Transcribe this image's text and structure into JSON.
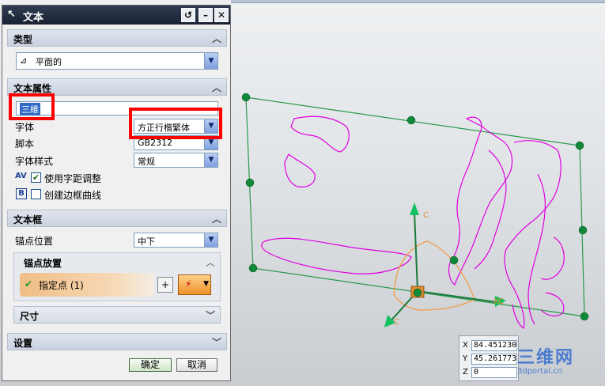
{
  "dialog": {
    "title": "文本",
    "buttons": {
      "reset": "↺",
      "minimize": "–",
      "close": "✕"
    },
    "type_section": {
      "header": "类型",
      "value": "平面的"
    },
    "text_props": {
      "header": "文本属性",
      "text_input": "三維",
      "font_label": "字体",
      "font_value": "方正行楷繁体",
      "script_label": "脚本",
      "script_value": "GB2312",
      "style_label": "字体样式",
      "style_value": "常规",
      "kerning_label": "使用字距调整",
      "kerning_checked": true,
      "border_label": "创建边框曲线",
      "border_checked": false
    },
    "text_frame": {
      "header": "文本框",
      "anchor_label": "锚点位置",
      "anchor_value": "中下",
      "placement_header": "锚点放置",
      "specify_point": "指定点 (1)",
      "size_header": "尺寸"
    },
    "settings_header": "设置",
    "ok": "确定",
    "cancel": "取消"
  },
  "viewport": {
    "axis_labels": {
      "zc": "C",
      "xc": "XC",
      "yc": "C"
    },
    "text_curves_color": "#e000e0",
    "frame_color": "#2a9a4a",
    "handle_color": "#11883a",
    "csys_color": "#f0a050"
  },
  "coords": {
    "x_label": "X",
    "x": "84.451230",
    "y_label": "Y",
    "y": "45.261773",
    "z_label": "Z",
    "z": "0"
  },
  "watermark": {
    "big": "三维网",
    "small": "3dportal.cn"
  },
  "icons": [
    "text-tool-icon",
    "planar-type-icon",
    "kerning-icon",
    "border-curve-icon",
    "check-icon",
    "point-constructor-icon",
    "point-snap-icon"
  ]
}
